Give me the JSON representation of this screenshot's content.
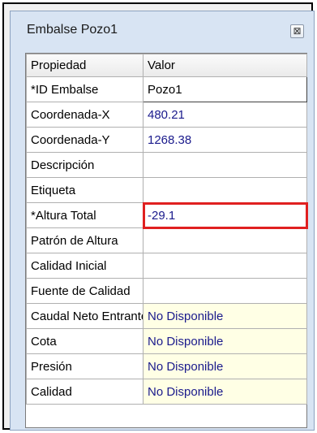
{
  "window": {
    "title": "Embalse Pozo1",
    "close_symbol": "⊠"
  },
  "table": {
    "headers": {
      "property": "Propiedad",
      "value": "Valor"
    },
    "rows": [
      {
        "property": "*ID Embalse",
        "value": "Pozo1"
      },
      {
        "property": "Coordenada-X",
        "value": "480.21"
      },
      {
        "property": "Coordenada-Y",
        "value": "1268.38"
      },
      {
        "property": "Descripción",
        "value": ""
      },
      {
        "property": "Etiqueta",
        "value": ""
      },
      {
        "property": "*Altura Total",
        "value": "-29.1"
      },
      {
        "property": "Patrón de Altura",
        "value": ""
      },
      {
        "property": "Calidad Inicial",
        "value": ""
      },
      {
        "property": "Fuente de Calidad",
        "value": ""
      },
      {
        "property": "Caudal Neto Entrante",
        "value": "No Disponible"
      },
      {
        "property": "Cota",
        "value": "No Disponible"
      },
      {
        "property": "Presión",
        "value": "No Disponible"
      },
      {
        "property": "Calidad",
        "value": "No Disponible"
      }
    ]
  },
  "colors": {
    "highlight": "#e02020",
    "readonly_bg": "#ffffe5",
    "value_text": "#1a1a8c"
  }
}
